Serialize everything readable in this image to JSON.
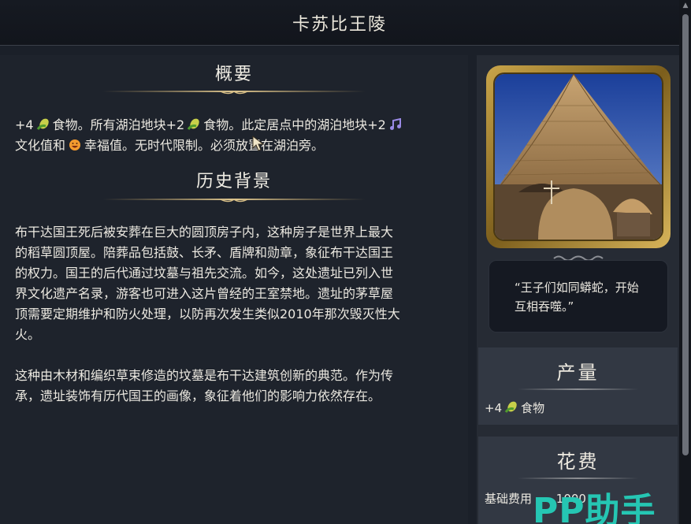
{
  "window": {
    "title": "卡苏比王陵"
  },
  "overview": {
    "heading": "概要",
    "line1_a": "+4",
    "line1_b": "食物。所有湖泊地块+2",
    "line1_c": "食物。此定居点中的湖泊地块+2",
    "line2_a": "文化值和",
    "line2_b": "幸福值。无时代限制。必须放置在湖泊旁。"
  },
  "history": {
    "heading": "历史背景",
    "para1_lines": [
      "布干达国王死后被安葬在巨大的圆顶房子内，这种房子是世界上最大",
      "的稻草圆顶屋。陪葬品包括鼓、长矛、盾牌和勋章，象征布干达国王",
      "的权力。国王的后代通过坟墓与祖先交流。如今，这处遗址已列入世",
      "界文化遗产名录，游客也可进入这片曾经的王室禁地。遗址的茅草屋",
      "顶需要定期维护和防火处理，以防再次发生类似2010年那次毁灭性大",
      "火。"
    ],
    "para2_lines": [
      "这种由木材和编织草束修造的坟墓是布干达建筑创新的典范。作为传",
      "承，遗址装饰有历代国王的画像，象征着他们的影响力依然存在。"
    ]
  },
  "quote": {
    "line1": "“王子们如同蟒蛇，开始",
    "line2": "互相吞噬。”"
  },
  "production": {
    "heading": "产量",
    "value": "+4",
    "label": "食物"
  },
  "cost": {
    "heading": "花费",
    "label": "基础费用",
    "value": "1000"
  },
  "watermark": {
    "text": "PP助手"
  },
  "icons": {
    "food": "corn-food-icon",
    "culture": "music-note-culture-icon",
    "happiness": "smiley-happiness-icon"
  },
  "colors": {
    "background": "#1b2029",
    "panel": "#262b34",
    "card": "#323843",
    "gold": "#c9a54a",
    "watermark": "#25c6b3"
  }
}
